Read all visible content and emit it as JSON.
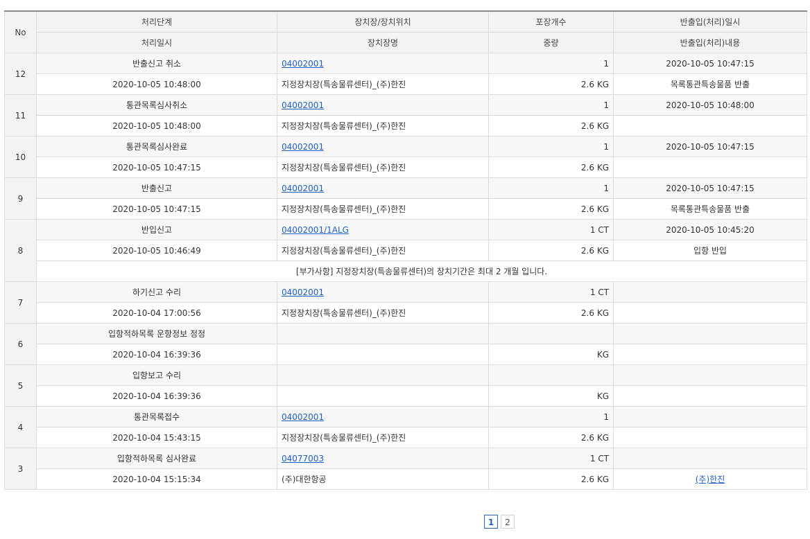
{
  "headers": {
    "no": "No",
    "row1": [
      "처리단계",
      "장치장/장치위치",
      "포장개수",
      "반출입(처리)일시"
    ],
    "row2": [
      "처리일시",
      "장치장명",
      "중량",
      "반출입(처리)내용"
    ]
  },
  "records": [
    {
      "no": "12",
      "step": "반출신고 취소",
      "location": "04002001",
      "packages": "1",
      "inout_datetime": "2020-10-05 10:47:15",
      "datetime": "2020-10-05 10:48:00",
      "place_name": "지정장치장(특송물류센터)_(주)한진",
      "weight": "2.6 KG",
      "inout_content": "목록통관특송물품 반출"
    },
    {
      "no": "11",
      "step": "통관목록심사취소",
      "location": "04002001",
      "packages": "1",
      "inout_datetime": "2020-10-05 10:48:00",
      "datetime": "2020-10-05 10:48:00",
      "place_name": "지정장치장(특송물류센터)_(주)한진",
      "weight": "2.6 KG",
      "inout_content": ""
    },
    {
      "no": "10",
      "step": "통관목록심사완료",
      "location": "04002001",
      "packages": "1",
      "inout_datetime": "2020-10-05 10:47:15",
      "datetime": "2020-10-05 10:47:15",
      "place_name": "지정장치장(특송물류센터)_(주)한진",
      "weight": "2.6 KG",
      "inout_content": ""
    },
    {
      "no": "9",
      "step": "반출신고",
      "location": "04002001",
      "packages": "1",
      "inout_datetime": "2020-10-05 10:47:15",
      "datetime": "2020-10-05 10:47:15",
      "place_name": "지정장치장(특송물류센터)_(주)한진",
      "weight": "2.6 KG",
      "inout_content": "목록통관특송물품 반출"
    },
    {
      "no": "8",
      "step": "반입신고",
      "location": "04002001/1ALG",
      "packages": "1 CT",
      "inout_datetime": "2020-10-05 10:45:20",
      "datetime": "2020-10-05 10:46:49",
      "place_name": "지정장치장(특송물류센터)_(주)한진",
      "weight": "2.6 KG",
      "inout_content": "입항 반입",
      "note": "[부가사항] 지정장치장(특송물류센터)의 장치기간은 최대 2 개월 입니다."
    },
    {
      "no": "7",
      "step": "하기신고 수리",
      "location": "04002001",
      "packages": "1 CT",
      "inout_datetime": "",
      "datetime": "2020-10-04 17:00:56",
      "place_name": "지정장치장(특송물류센터)_(주)한진",
      "weight": "2.6 KG",
      "inout_content": ""
    },
    {
      "no": "6",
      "step": "입항적하목록 운항정보 정정",
      "location": "",
      "packages": "",
      "inout_datetime": "",
      "datetime": "2020-10-04 16:39:36",
      "place_name": "",
      "weight": "KG",
      "inout_content": ""
    },
    {
      "no": "5",
      "step": "입항보고 수리",
      "location": "",
      "packages": "",
      "inout_datetime": "",
      "datetime": "2020-10-04 16:39:36",
      "place_name": "",
      "weight": "KG",
      "inout_content": ""
    },
    {
      "no": "4",
      "step": "통관목록접수",
      "location": "04002001",
      "packages": "1",
      "inout_datetime": "",
      "datetime": "2020-10-04 15:43:15",
      "place_name": "지정장치장(특송물류센터)_(주)한진",
      "weight": "2.6 KG",
      "inout_content": ""
    },
    {
      "no": "3",
      "step": "입항적하목록 심사완료",
      "location": "04077003",
      "packages": "1 CT",
      "inout_datetime": "",
      "datetime": "2020-10-04 15:15:34",
      "place_name": "(주)대한항공",
      "weight": "2.6 KG",
      "inout_content": "(주)한진",
      "inout_content_link": true
    }
  ],
  "pagination": {
    "pages": [
      "1",
      "2"
    ],
    "current": "1"
  }
}
